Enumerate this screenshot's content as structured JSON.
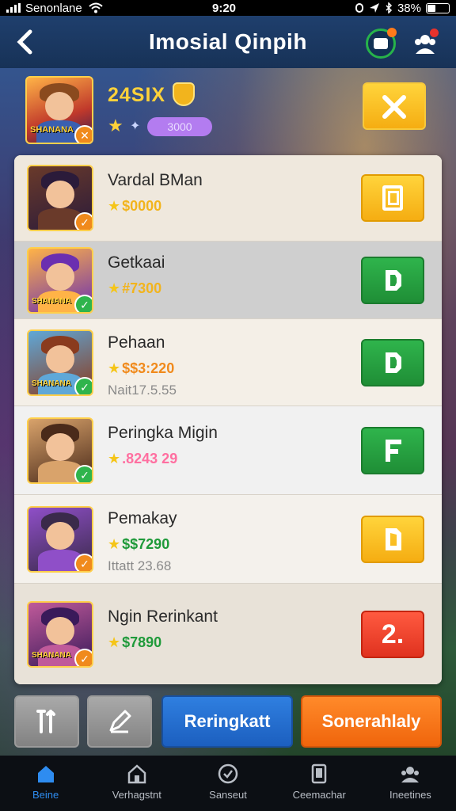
{
  "status_bar": {
    "carrier": "Senonlane",
    "time": "9:20",
    "battery": "38%",
    "battery_level": 0.38
  },
  "header": {
    "back_icon": "chevron-left-icon",
    "title": "Imosial Qinpih",
    "chat_icon": "chat-bubble-icon",
    "team_icon": "team-icon"
  },
  "top_player": {
    "name": "24SIX",
    "points": "3000",
    "action_icon": "cross-swords-icon",
    "avatar_caption": "SHANANA"
  },
  "rows": [
    {
      "name": "Vardal BMan",
      "score": "$0000",
      "score_color": "#f2b41d",
      "sub": "",
      "button_color": "yellow",
      "button_icon": "card-icon",
      "badge_color": "#f08a1c",
      "avatar_colors": [
        "#6a3a2a",
        "#2b1b3a"
      ],
      "avatar_caption": ""
    },
    {
      "name": "Getkaai",
      "score": "#7300",
      "score_color": "#f2b41d",
      "sub": "",
      "button_color": "green",
      "button_icon": "pixel-d-icon",
      "badge_color": "#2fb44c",
      "avatar_colors": [
        "#ffb347",
        "#6b2fb0"
      ],
      "avatar_caption": "SHANANA"
    },
    {
      "name": "Pehaan",
      "score": "$$3:220",
      "score_color": "#f08a1c",
      "sub": "Nait17.5.55",
      "button_color": "green",
      "button_icon": "pixel-d-icon",
      "badge_color": "#2fb44c",
      "avatar_colors": [
        "#5fa8d8",
        "#8a3b1e"
      ],
      "avatar_caption": "SHANANA"
    },
    {
      "name": "Peringka Migin",
      "score": ".8243 29",
      "score_color": "#ff6fa0",
      "sub": "",
      "button_color": "green",
      "button_icon": "pixel-f-icon",
      "badge_color": "#2fb44c",
      "avatar_colors": [
        "#d9a36b",
        "#4a2a1a"
      ],
      "avatar_caption": ""
    },
    {
      "name": "Pemakay",
      "score": "$$7290",
      "score_color": "#1f9a3a",
      "sub": "Ittatt 23.68",
      "button_color": "yellow",
      "button_icon": "pixel-a-icon",
      "badge_color": "#f08a1c",
      "avatar_colors": [
        "#8f4fc8",
        "#3a2a4a"
      ],
      "avatar_caption": ""
    },
    {
      "name": "Ngin Rerinkant",
      "score": "$7890",
      "score_color": "#1f9a3a",
      "sub": "",
      "button_color": "red",
      "button_icon": "number-two-icon",
      "button_text": "2.",
      "badge_color": "#f08a1c",
      "avatar_colors": [
        "#c05a9a",
        "#3a1a5a"
      ],
      "avatar_caption": "SHANANA"
    }
  ],
  "actions": [
    {
      "icon": "tools-icon",
      "label": ""
    },
    {
      "icon": "pencil-icon",
      "label": ""
    },
    {
      "icon": "",
      "label": "Reringkatt"
    },
    {
      "icon": "",
      "label": "Sonerahlaly"
    }
  ],
  "tabs": [
    {
      "label": "Beine",
      "icon": "home-icon",
      "active": true
    },
    {
      "label": "Verhagstnt",
      "icon": "house-outline-icon",
      "active": false
    },
    {
      "label": "Sanseut",
      "icon": "check-circle-icon",
      "active": false
    },
    {
      "label": "Ceemachar",
      "icon": "card-icon",
      "active": false
    },
    {
      "label": "Ineetines",
      "icon": "group-icon",
      "active": false
    }
  ]
}
